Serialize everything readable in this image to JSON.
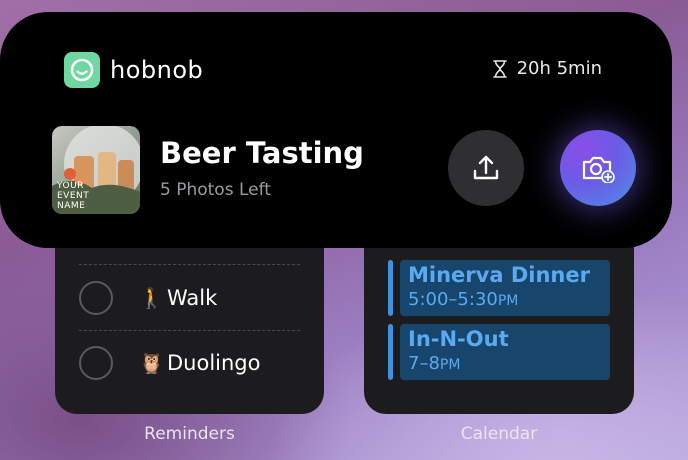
{
  "island": {
    "app_name": "hobnob",
    "timer": "20h 5min",
    "thumbnail_text": "YOUR\nEVENT\nNAME",
    "event_title": "Beer Tasting",
    "event_subtitle": "5 Photos Left",
    "icons": {
      "app": "hobnob-logo-icon",
      "timer": "hourglass-icon",
      "upload": "upload-icon",
      "camera": "camera-add-icon"
    },
    "colors": {
      "app_icon_bg": "#6fd7a0",
      "camera_gradient": [
        "#8a4de8",
        "#4f8fe6"
      ]
    }
  },
  "reminders": {
    "label": "Reminders",
    "items": [
      {
        "emoji": "🚶",
        "text": "Walk"
      },
      {
        "emoji": "🦉",
        "text": "Duolingo"
      }
    ]
  },
  "calendar": {
    "label": "Calendar",
    "events": [
      {
        "title": "Minerva Dinner",
        "time": "5:00–5:30",
        "ampm": "PM"
      },
      {
        "title": "In-N-Out",
        "time": "7–8",
        "ampm": "PM"
      }
    ],
    "colors": {
      "event_text": "#5aaaf2",
      "event_bg": "#18456b",
      "event_bar": "#3d8fe0"
    }
  }
}
